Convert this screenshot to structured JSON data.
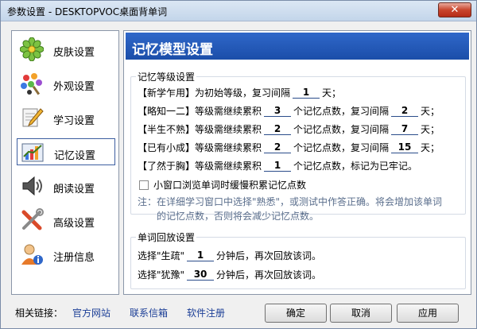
{
  "window": {
    "title": "参数设置 - DESKTOPVOC桌面背单词",
    "close_label": "✕"
  },
  "sidebar": {
    "items": [
      {
        "label": "皮肤设置"
      },
      {
        "label": "外观设置"
      },
      {
        "label": "学习设置"
      },
      {
        "label": "记忆设置"
      },
      {
        "label": "朗读设置"
      },
      {
        "label": "高级设置"
      },
      {
        "label": "注册信息"
      }
    ]
  },
  "main": {
    "banner": "记忆模型设置",
    "levels": {
      "title": "记忆等级设置",
      "rows": [
        {
          "pre": "【新学乍用】为初始等级，复习间隔",
          "v2": "1",
          "post": "天；"
        },
        {
          "pre": "【略知一二】等级需继续累积",
          "v1": "3",
          "mid": "个记忆点数，复习间隔",
          "v2": "2",
          "post": "天；"
        },
        {
          "pre": "【半生不熟】等级需继续累积",
          "v1": "2",
          "mid": "个记忆点数，复习间隔",
          "v2": "7",
          "post": "天；"
        },
        {
          "pre": "【已有小成】等级需继续累积",
          "v1": "2",
          "mid": "个记忆点数，复习间隔",
          "v2": "15",
          "post": "天；"
        },
        {
          "pre": "【了然于胸】等级需继续累积",
          "v1": "1",
          "mid": "个记忆点数，标记为已牢记。"
        }
      ],
      "checkbox_label": "小窗口浏览单词时缓慢积累记忆点数",
      "note_line1": "注：在详细学习窗口中选择\"熟悉\"，或测试中作答正确。将会增加该单词",
      "note_line2": "的记忆点数，否则将会减少记忆点数。"
    },
    "replay": {
      "title": "单词回放设置",
      "row1": {
        "pre": "选择\"生疏\"",
        "val": "1",
        "post": "分钟后，再次回放该词。"
      },
      "row2": {
        "pre": "选择\"犹豫\"",
        "val": "30",
        "post": "分钟后，再次回放该词。"
      }
    }
  },
  "footer": {
    "lead": "相关链接：",
    "links": [
      "官方网站",
      "联系信箱",
      "软件注册"
    ],
    "ok": "确定",
    "cancel": "取消",
    "apply": "应用"
  },
  "colors": {
    "banner": "#2f67c9",
    "link": "#1b3e96",
    "note": "#5a6e8c"
  }
}
